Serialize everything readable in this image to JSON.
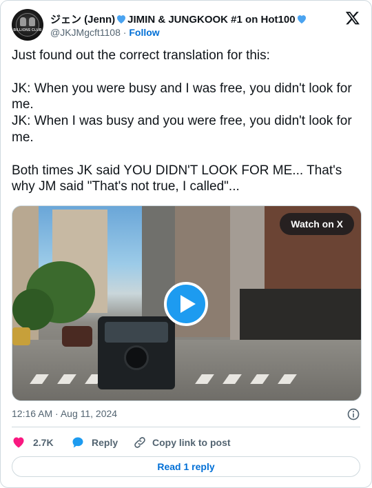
{
  "author": {
    "name_part1": "ジェン (Jenn)",
    "name_part2": "JIMIN & JUNGKOOK #1 on Hot100",
    "handle": "@JKJMgcft1108",
    "separator": "·",
    "follow_label": "Follow",
    "avatar_text": "BILLIONS CLUB",
    "heart_color": "#4aa3f0"
  },
  "tweet": {
    "text": "Just found out the correct translation for this:\n\nJK: When you were busy and I was free, you didn't look for me.\nJK: When I was busy and you were free, you didn't look for me.\n\nBoth times JK said YOU DIDN'T LOOK FOR ME... That's why JM said \"That's not true, I called\"..."
  },
  "media": {
    "watch_label": "Watch on X",
    "play_icon": "play-icon"
  },
  "meta": {
    "timestamp": "12:16 AM · Aug 11, 2024"
  },
  "actions": {
    "like_count": "2.7K",
    "reply_label": "Reply",
    "copy_label": "Copy link to post"
  },
  "footer": {
    "read_reply_label": "Read 1 reply"
  },
  "colors": {
    "accent": "#1d9bf0",
    "link": "#006fd6",
    "like": "#f91880",
    "muted": "#536471"
  }
}
